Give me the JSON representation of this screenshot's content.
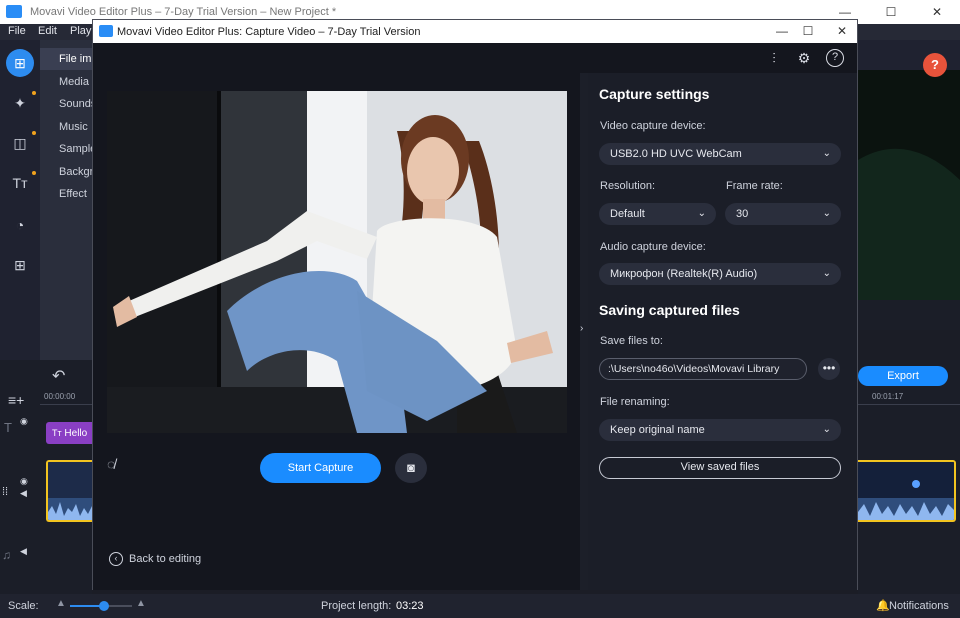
{
  "main_window": {
    "title": "Movavi Video Editor Plus – 7-Day Trial Version – New Project *",
    "menu": [
      "File",
      "Edit",
      "Playb"
    ],
    "left_list": [
      "File imp",
      "Media",
      "Sounds",
      "Music",
      "Sample",
      "Backgr",
      "Effect"
    ],
    "timeline": {
      "time_left": "00:00:00",
      "time_right": "00:01:17",
      "title_clip": "Hello"
    },
    "export_label": "Export",
    "help_badge": "?",
    "status": {
      "scale_label": "Scale:",
      "project_length_label": "Project length:",
      "project_length_value": "03:23",
      "notifications_label": "Notifications"
    }
  },
  "dialog": {
    "title": "Movavi Video Editor Plus: Capture Video – 7-Day Trial Version",
    "start_capture_label": "Start Capture",
    "back_label": "Back to editing",
    "settings": {
      "capture_heading": "Capture settings",
      "video_device_label": "Video capture device:",
      "video_device_value": "USB2.0 HD UVC WebCam",
      "resolution_label": "Resolution:",
      "resolution_value": "Default",
      "frame_rate_label": "Frame rate:",
      "frame_rate_value": "30",
      "audio_device_label": "Audio capture device:",
      "audio_device_value": "Микрофон (Realtek(R) Audio)",
      "saving_heading": "Saving captured files",
      "save_to_label": "Save files to:",
      "save_to_value": ":\\Users\\no46o\\Videos\\Movavi Library",
      "renaming_label": "File renaming:",
      "renaming_value": "Keep original name",
      "view_saved_label": "View saved files"
    }
  },
  "colors": {
    "accent": "#1a8cff",
    "title_clip": "#8a3fc4",
    "help_badge": "#e8533b"
  }
}
